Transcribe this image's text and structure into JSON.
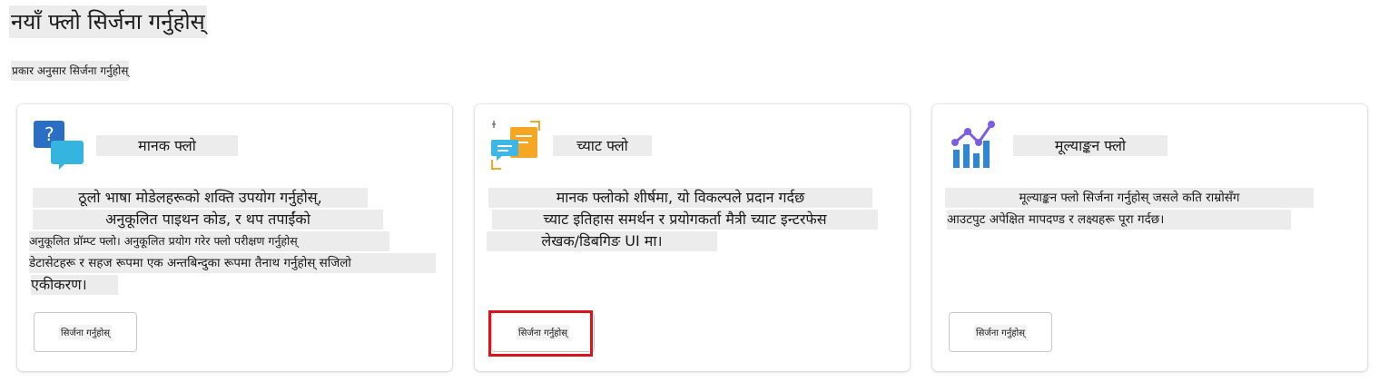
{
  "page": {
    "title": "नयाँ फ्लो सिर्जना गर्नुहोस्",
    "subtitle": "प्रकार अनुसार सिर्जना गर्नुहोस्"
  },
  "cards": [
    {
      "title": "मानक फ्लो",
      "icon": "chat-question-icon",
      "desc_lines": [
        "ठूलो भाषा मोडेलहरूको शक्ति उपयोग गर्नुहोस्,",
        "अनुकूलित पाइथन कोड, र थप तपाईंको",
        "अनुकूलित प्रॉम्प्ट फ्लो। अनुकूलित प्रयोग गरेर फ्लो परीक्षण गर्नुहोस्",
        "डेटासेटहरू र सहज रूपमा एक अन्तबिन्दुका रूपमा तैनाथ गर्नुहोस् सजिलो",
        "एकीकरण।"
      ],
      "button_label": "सिर्जना गर्नुहोस्"
    },
    {
      "title": "च्याट फ्लो",
      "icon": "chat-document-icon",
      "desc_lines": [
        "मानक फ्लोको शीर्षमा, यो विकल्पले प्रदान गर्दछ",
        "च्याट इतिहास समर्थन र प्रयोगकर्ता मैत्री च्याट इन्टरफेस",
        "लेखक/डिबगिङ UI मा।"
      ],
      "button_label": "सिर्जना गर्नुहोस्"
    },
    {
      "title": "मूल्याङ्कन फ्लो",
      "icon": "evaluation-chart-icon",
      "desc_lines": [
        "मूल्याङ्कन फ्लो सिर्जना गर्नुहोस् जसले कति राम्रोसँग",
        "आउटपुट अपेक्षित मापदण्ड र लक्ष्यहरू पूरा गर्दछ।"
      ],
      "button_label": "सिर्जना गर्नुहोस्"
    }
  ],
  "colors": {
    "highlight_bg": "#ececec",
    "focus_ring": "#d9141b",
    "icon_blue": "#2f86d6",
    "icon_cyan": "#36b4e0",
    "icon_orange": "#f5a623",
    "icon_purple": "#7b5ee0"
  }
}
